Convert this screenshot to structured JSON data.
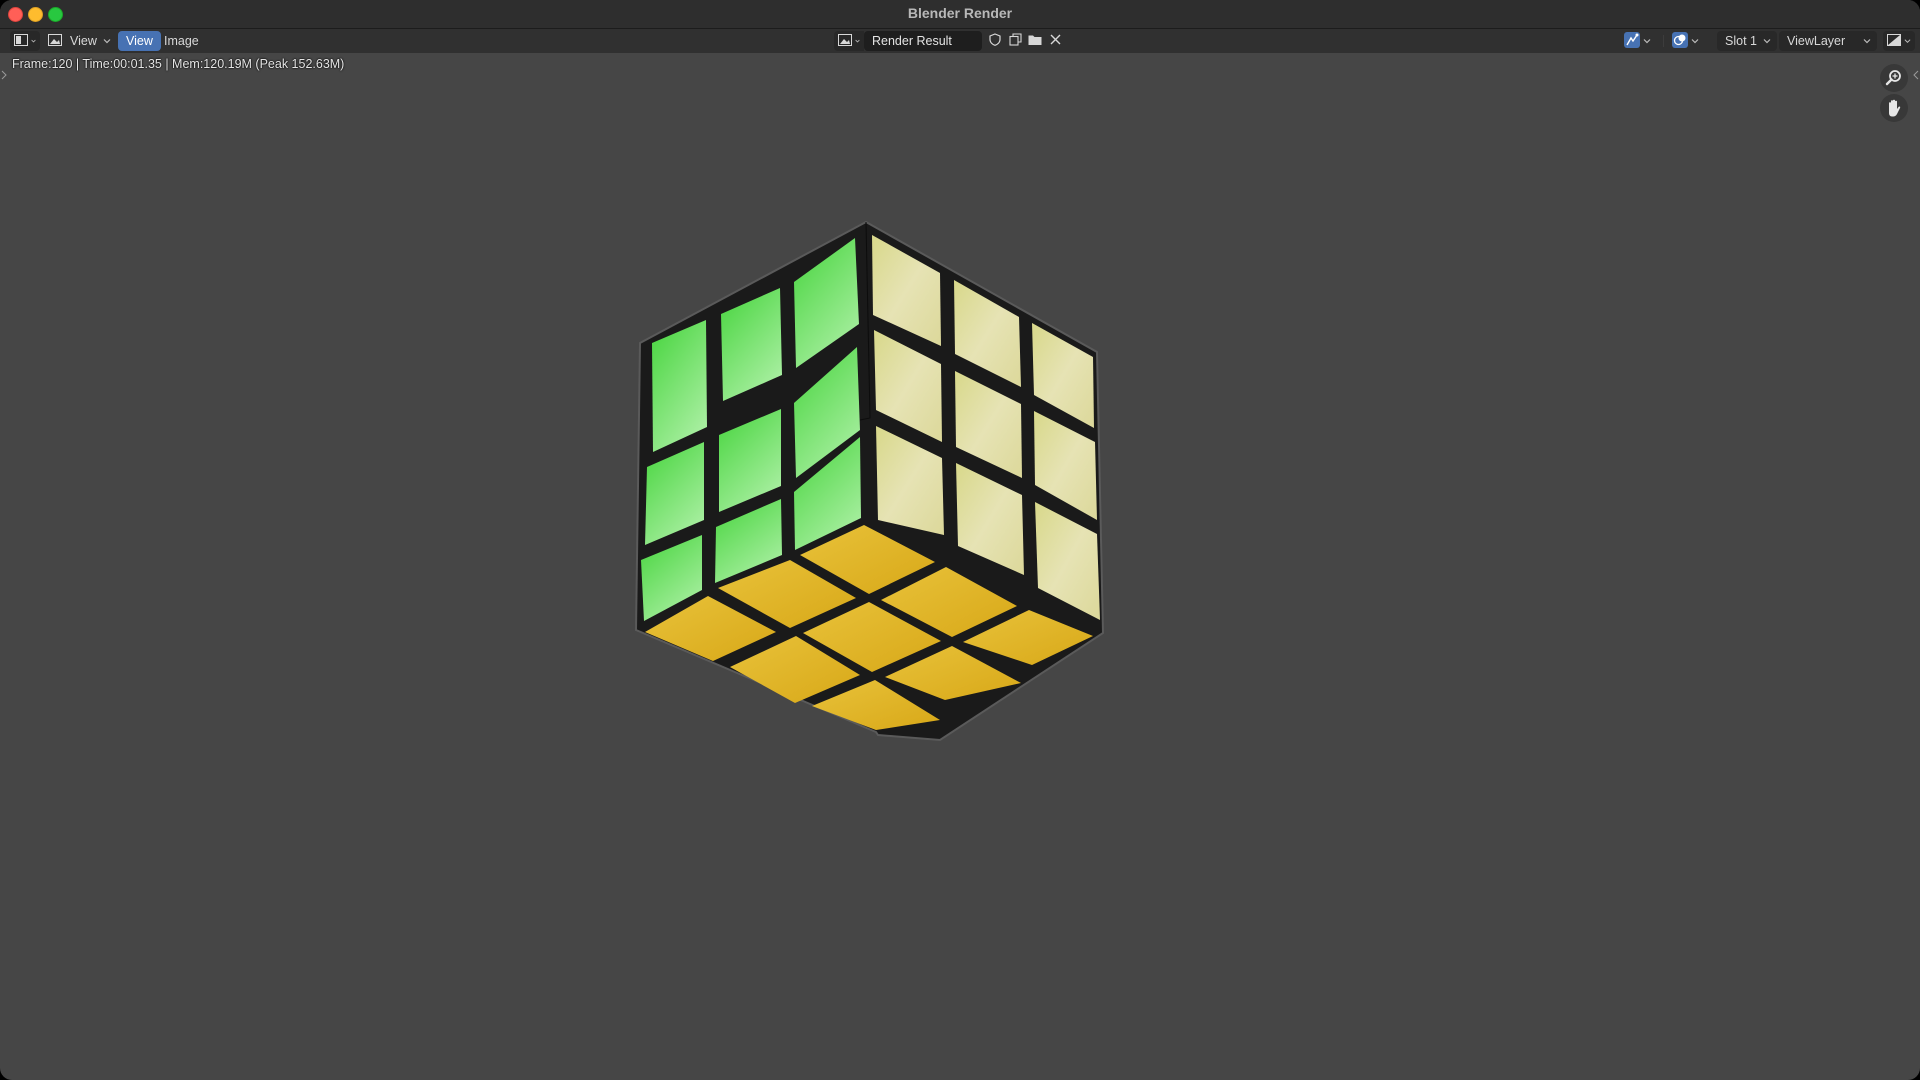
{
  "window": {
    "title": "Blender Render"
  },
  "header": {
    "menus": {
      "view_label": "View",
      "view_active_label": "View",
      "image_label": "Image"
    },
    "image_name": "Render Result",
    "slot": "Slot 1",
    "view_layer": "ViewLayer"
  },
  "status": {
    "render_info": "Frame:120 | Time:00:01.35 | Mem:120.19M (Peak 152.63M)"
  },
  "render": {
    "subject": "rubiks-cube",
    "colors": {
      "green_face": "#4fdc4a",
      "cream_face": "#e6e3a8",
      "yellow_face": "#e2b62a",
      "plastic_body": "#1a1a1a",
      "background": "#464646"
    }
  },
  "icons": {
    "editor_type": "image-editor-icon",
    "image_browse": "image-browse-icon",
    "fake_user": "shield-icon",
    "duplicate": "duplicate-icon",
    "open": "folder-icon",
    "unlink": "close-icon",
    "gizmo": "gizmo-icon",
    "overlay": "overlay-icon",
    "display_channels": "display-channels-icon",
    "zoom": "zoom-icon",
    "pan": "hand-icon"
  }
}
